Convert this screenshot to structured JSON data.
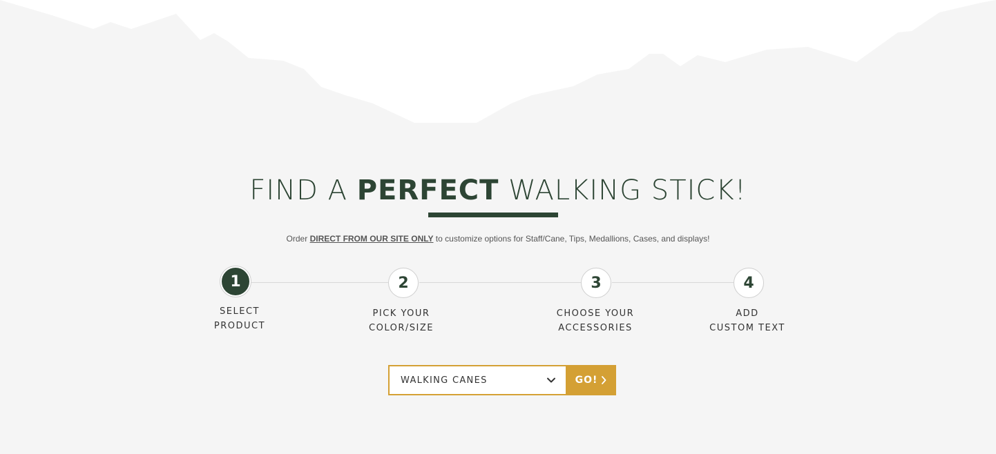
{
  "colors": {
    "brand_green": "#2d4534",
    "accent_gold": "#d4a034",
    "background": "#f5f5f5"
  },
  "headline": {
    "part1": "FIND A ",
    "bold": "PERFECT",
    "part2": " WALKING STICK!"
  },
  "subtitle": {
    "prefix": "Order ",
    "link": "DIRECT FROM OUR SITE ONLY",
    "suffix": " to customize options for Staff/Cane, Tips, Medallions, Cases, and displays!"
  },
  "steps": [
    {
      "number": "1",
      "line1": "SELECT",
      "line2": "PRODUCT",
      "active": true
    },
    {
      "number": "2",
      "line1": "PICK YOUR",
      "line2": "COLOR/SIZE",
      "active": false
    },
    {
      "number": "3",
      "line1": "CHOOSE YOUR",
      "line2": "ACCESSORIES",
      "active": false
    },
    {
      "number": "4",
      "line1": "ADD",
      "line2": "CUSTOM TEXT",
      "active": false
    }
  ],
  "product_select": {
    "value": "WALKING CANES"
  },
  "go_button": {
    "label": "GO!"
  }
}
